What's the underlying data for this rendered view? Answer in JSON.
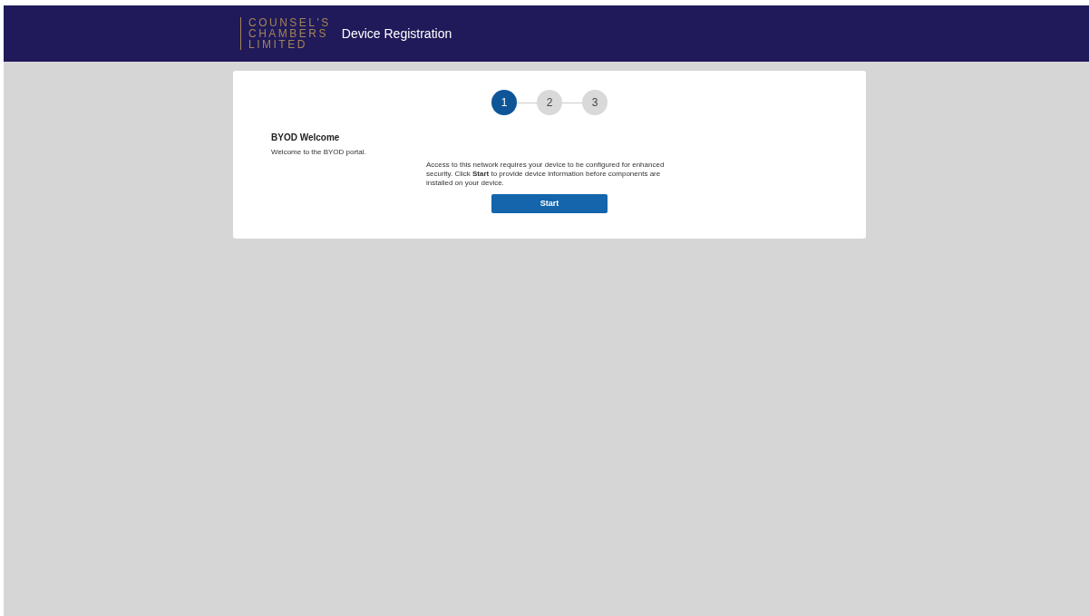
{
  "header": {
    "logo_lines": [
      "COUNSEL'S",
      "CHAMBERS",
      "LIMITED"
    ],
    "title": "Device Registration"
  },
  "steps": [
    {
      "label": "1",
      "selected": true
    },
    {
      "label": "2",
      "selected": false
    },
    {
      "label": "3",
      "selected": false
    }
  ],
  "welcome": {
    "heading": "BYOD Welcome",
    "text": "Welcome to the BYOD portal."
  },
  "description": "Access to this network requires your device to be configured for enhanced security. Click **Start** to provide device information before components are installed on your device.",
  "start_button": "Start"
}
